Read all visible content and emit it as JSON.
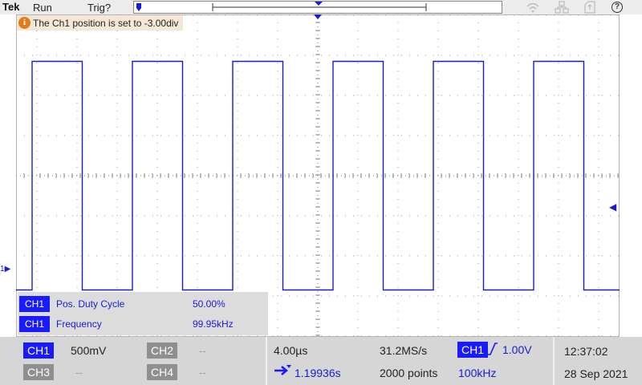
{
  "top_bar": {
    "brand": "Tek",
    "acq_state": "Run",
    "trigger_state": "Trig?"
  },
  "message": {
    "icon": "i",
    "text": "The Ch1 position is set to -3.00div"
  },
  "waveform": {
    "channel": "CH1",
    "channel_marker": "1",
    "color": "#1a1ad0",
    "rising_edges_div": [
      0.4,
      2.9,
      5.4,
      7.9,
      10.4,
      12.9
    ],
    "period_div": 2.5,
    "high_level_div": 2.85,
    "low_level_div": -2.85
  },
  "measurements": [
    {
      "channel": "CH1",
      "name": "Pos. Duty Cycle",
      "value": "50.00%"
    },
    {
      "channel": "CH1",
      "name": "Frequency",
      "value": "99.95kHz"
    }
  ],
  "bottom_bar": {
    "channels": [
      {
        "label": "CH1",
        "value": "500mV",
        "active": true
      },
      {
        "label": "CH2",
        "value": "--",
        "active": false
      },
      {
        "label": "CH3",
        "value": "--",
        "active": false
      },
      {
        "label": "CH4",
        "value": "--",
        "active": false
      }
    ],
    "horizontal": {
      "scale": "4.00µs",
      "position": "1.19936s",
      "sample_rate": "31.2MS/s",
      "record_length": "2000 points"
    },
    "trigger": {
      "source": "CH1",
      "slope": "rising",
      "level": "1.00V",
      "frequency": "100kHz"
    },
    "clock": {
      "time": "12:37:02",
      "date": "28 Sep 2021"
    }
  },
  "colors": {
    "accent": "#1a1aff",
    "trace": "#1a1ad0",
    "info": "#e07b1a"
  }
}
